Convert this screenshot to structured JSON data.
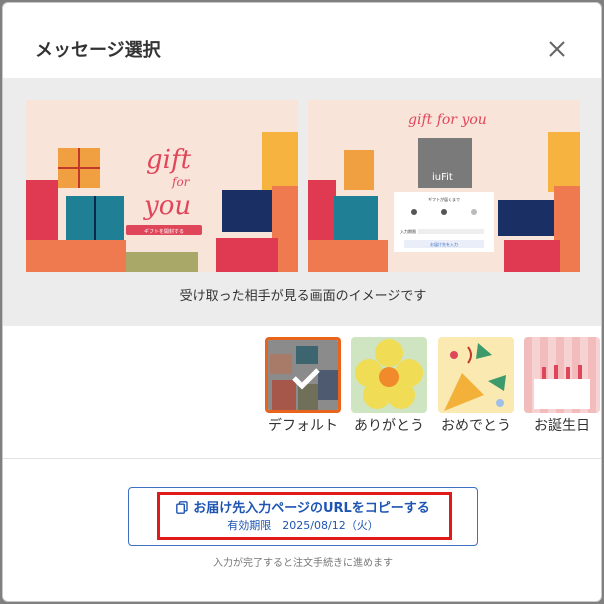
{
  "dialog": {
    "title": "メッセージ選択",
    "close_icon": "close-icon"
  },
  "preview": {
    "left_card": {
      "script_lines": [
        "gift",
        "for",
        "you"
      ],
      "button_text": "ギフトを開封する"
    },
    "right_card": {
      "script_text": "gift for you",
      "photo_text": "iuFit",
      "panel_title": "ギフトが届くまで",
      "panel_url_label": "入力期限",
      "panel_button": "お届け先を入力"
    },
    "caption": "受け取った相手が見る画面のイメージです"
  },
  "themes": [
    {
      "label": "デフォルト",
      "selected": true,
      "icon": "check-icon"
    },
    {
      "label": "ありがとう",
      "selected": false
    },
    {
      "label": "おめでとう",
      "selected": false
    },
    {
      "label": "お誕生日",
      "selected": false
    }
  ],
  "copy_button": {
    "label": "お届け先入力ページのURLをコピーする",
    "expiry": "有効期限　2025/08/12（火）",
    "icon": "copy-icon"
  },
  "hint": "入力が完了すると注文手続きに進めます",
  "colors": {
    "accent_blue": "#1e55b3",
    "highlight_red": "#e01919",
    "selected_orange": "#e8641c",
    "card_bg": "#f9e4da"
  }
}
